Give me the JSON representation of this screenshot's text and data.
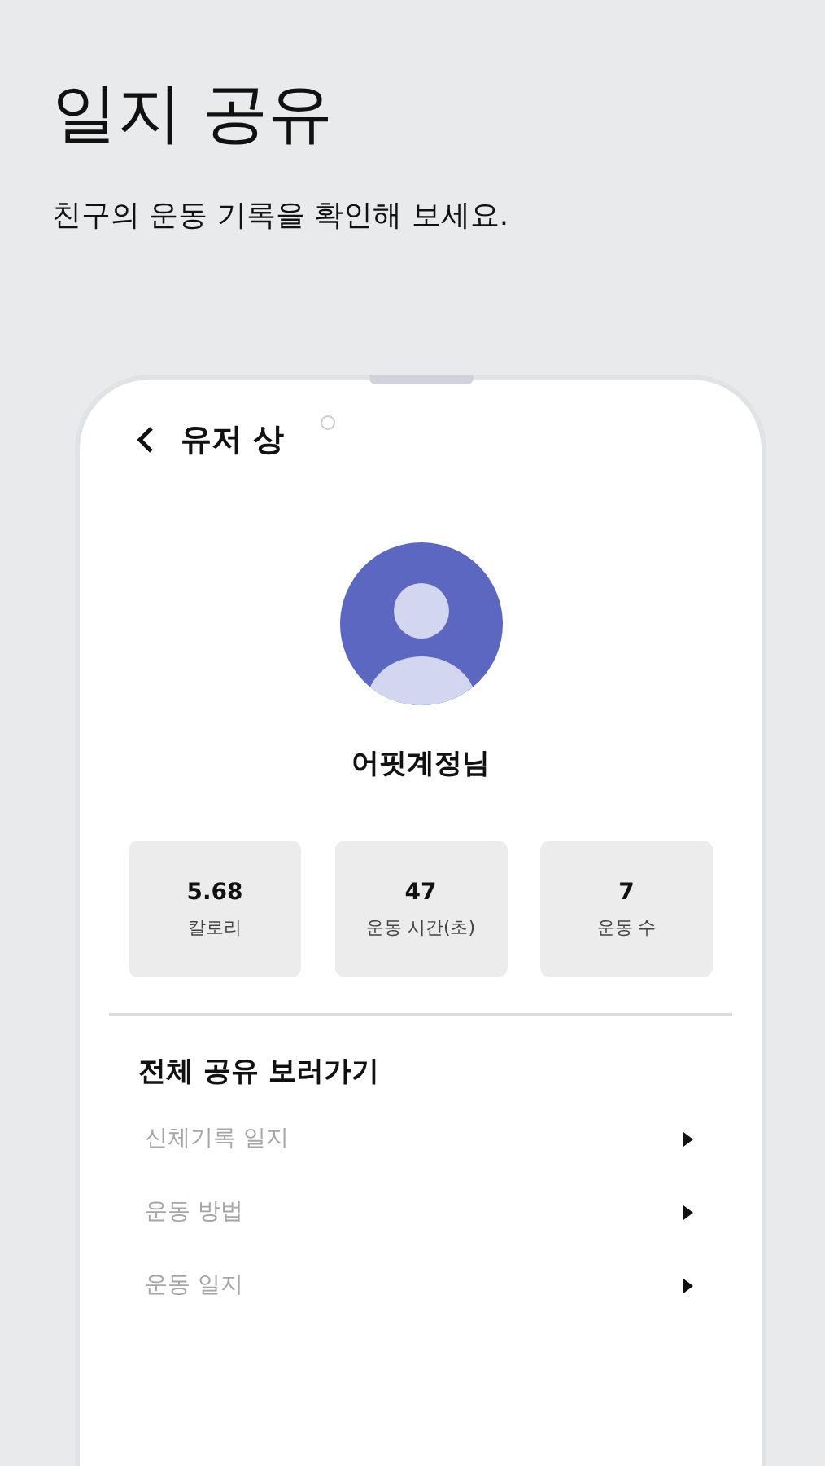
{
  "page": {
    "title": "일지 공유",
    "subtitle": "친구의 운동 기록을 확인해 보세요."
  },
  "screen": {
    "title": "유저 상",
    "user_name": "어핏계정님",
    "stats": [
      {
        "value": "5.68",
        "label": "칼로리"
      },
      {
        "value": "47",
        "label": "운동 시간(초)"
      },
      {
        "value": "7",
        "label": "운동 수"
      }
    ],
    "section_title": "전체 공유 보러가기",
    "links": [
      {
        "label": "신체기록 일지"
      },
      {
        "label": "운동 방법"
      },
      {
        "label": "운동 일지"
      }
    ]
  }
}
